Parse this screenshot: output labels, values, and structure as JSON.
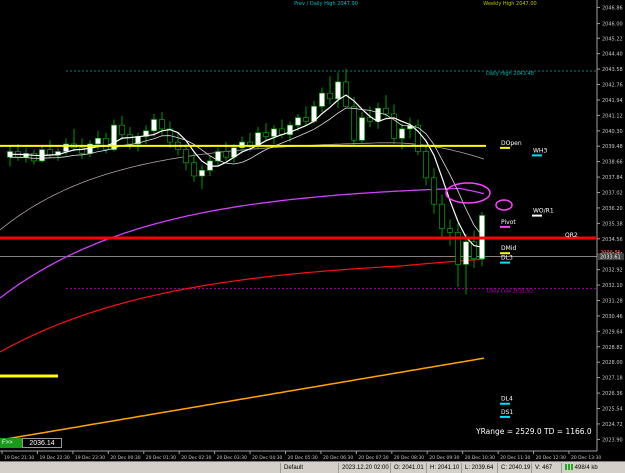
{
  "chart_data": {
    "type": "candlestick",
    "timeframe_labels": [
      "19 Dec 21:30",
      "19 Dec 22:30",
      "19 Dec 23:30",
      "20 Dec 00:30",
      "20 Dec 01:30",
      "20 Dec 02:30",
      "20 Dec 03:30",
      "20 Dec 04:30",
      "20 Dec 05:30",
      "20 Dec 06:30",
      "20 Dec 07:30",
      "20 Dec 08:30",
      "20 Dec 09:30",
      "20 Dec 10:30",
      "20 Dec 11:30",
      "20 Dec 12:30",
      "20 Dec 13:30"
    ],
    "y_ticks": [
      "2046.86",
      "2046.00",
      "2045.22",
      "2044.40",
      "2043.58",
      "2042.76",
      "2041.94",
      "2041.12",
      "2040.30",
      "2039.48",
      "2038.66",
      "2037.84",
      "2037.02",
      "2036.20",
      "2035.38",
      "2034.56",
      "2033.74",
      "2032.92",
      "2032.10",
      "2031.28",
      "2030.46",
      "2029.64",
      "2028.82",
      "2028.00",
      "2027.18",
      "2026.36",
      "2025.54",
      "2024.72",
      "2023.90"
    ],
    "ylim": [
      2023.6,
      2047.2
    ],
    "current_price_tag": "2033.61",
    "price_tag_2": "2033.86",
    "candles": [
      [
        2038.9,
        2039.5,
        2038.4,
        2039.2
      ],
      [
        2039.2,
        2039.6,
        2038.7,
        2038.9
      ],
      [
        2038.9,
        2039.4,
        2038.6,
        2039.1
      ],
      [
        2039.1,
        2039.3,
        2038.5,
        2038.7
      ],
      [
        2038.7,
        2039.5,
        2038.6,
        2039.3
      ],
      [
        2039.3,
        2039.8,
        2038.9,
        2039.0
      ],
      [
        2039.0,
        2039.4,
        2038.7,
        2039.2
      ],
      [
        2039.2,
        2039.9,
        2039.0,
        2039.6
      ],
      [
        2039.6,
        2040.4,
        2039.2,
        2039.4
      ],
      [
        2039.4,
        2039.9,
        2038.8,
        2039.1
      ],
      [
        2039.1,
        2039.8,
        2038.9,
        2039.6
      ],
      [
        2039.6,
        2040.3,
        2039.3,
        2039.9
      ],
      [
        2039.9,
        2040.2,
        2039.1,
        2039.3
      ],
      [
        2039.3,
        2040.9,
        2039.2,
        2040.6
      ],
      [
        2040.6,
        2041.1,
        2039.8,
        2040.1
      ],
      [
        2040.1,
        2040.5,
        2039.3,
        2039.6
      ],
      [
        2039.6,
        2040.2,
        2039.2,
        2040.0
      ],
      [
        2040.0,
        2040.6,
        2039.6,
        2040.3
      ],
      [
        2040.3,
        2041.2,
        2040.0,
        2040.9
      ],
      [
        2040.9,
        2041.3,
        2040.1,
        2040.4
      ],
      [
        2040.4,
        2040.8,
        2039.4,
        2039.7
      ],
      [
        2039.7,
        2040.2,
        2039.0,
        2039.3
      ],
      [
        2039.3,
        2039.6,
        2038.2,
        2038.6
      ],
      [
        2038.6,
        2039.1,
        2037.6,
        2037.9
      ],
      [
        2037.9,
        2038.5,
        2037.2,
        2038.2
      ],
      [
        2038.2,
        2039.0,
        2037.9,
        2038.7
      ],
      [
        2038.7,
        2039.4,
        2038.4,
        2039.2
      ],
      [
        2039.2,
        2039.7,
        2038.7,
        2038.9
      ],
      [
        2038.9,
        2039.6,
        2038.6,
        2039.4
      ],
      [
        2039.4,
        2040.0,
        2039.1,
        2039.7
      ],
      [
        2039.7,
        2040.2,
        2039.2,
        2039.5
      ],
      [
        2039.5,
        2040.5,
        2039.3,
        2040.2
      ],
      [
        2040.2,
        2040.7,
        2039.8,
        2040.0
      ],
      [
        2040.0,
        2040.6,
        2039.6,
        2040.4
      ],
      [
        2040.4,
        2040.9,
        2039.9,
        2040.1
      ],
      [
        2040.1,
        2040.8,
        2039.7,
        2040.6
      ],
      [
        2040.6,
        2041.2,
        2040.3,
        2041.0
      ],
      [
        2041.0,
        2041.6,
        2040.6,
        2040.8
      ],
      [
        2040.8,
        2041.9,
        2040.7,
        2041.6
      ],
      [
        2041.6,
        2042.6,
        2041.3,
        2042.3
      ],
      [
        2042.3,
        2043.2,
        2041.7,
        2042.0
      ],
      [
        2042.0,
        2043.4,
        2041.5,
        2042.9
      ],
      [
        2042.9,
        2043.6,
        2041.8,
        2041.6
      ],
      [
        2041.6,
        2042.1,
        2039.5,
        2039.8
      ],
      [
        2039.8,
        2041.3,
        2039.6,
        2041.0
      ],
      [
        2041.0,
        2041.6,
        2040.5,
        2040.8
      ],
      [
        2040.8,
        2041.8,
        2040.4,
        2041.5
      ],
      [
        2041.5,
        2042.2,
        2041.0,
        2041.2
      ],
      [
        2041.2,
        2041.7,
        2039.6,
        2039.9
      ],
      [
        2039.9,
        2040.7,
        2039.3,
        2040.4
      ],
      [
        2040.4,
        2041.0,
        2039.9,
        2040.6
      ],
      [
        2040.6,
        2040.9,
        2039.0,
        2039.2
      ],
      [
        2039.2,
        2039.6,
        2037.4,
        2037.8
      ],
      [
        2037.8,
        2038.3,
        2035.9,
        2036.4
      ],
      [
        2036.4,
        2036.9,
        2034.6,
        2035.1
      ],
      [
        2035.1,
        2035.6,
        2034.2,
        2034.9
      ],
      [
        2034.9,
        2035.4,
        2032.0,
        2033.2
      ],
      [
        2033.2,
        2034.8,
        2031.6,
        2034.4
      ],
      [
        2034.4,
        2035.0,
        2033.0,
        2033.5
      ],
      [
        2033.5,
        2036.0,
        2033.1,
        2035.8
      ]
    ],
    "h_lines": [
      {
        "name": "Prev / Daily High 2047.00",
        "price": 2047.0,
        "color": "#00c0c0"
      },
      {
        "name": "Weekly High 2047.00",
        "price": 2047.0,
        "color": "#c0c000"
      },
      {
        "name": "Daily High 2043.48",
        "price": 2043.48,
        "color": "#00b0b0"
      },
      {
        "name": "Daily Low 2031.92",
        "price": 2031.92,
        "color": "#c000c0"
      }
    ],
    "levels": [
      {
        "label": "DOpen",
        "price": 2039.5,
        "color": "#ffff00"
      },
      {
        "label": "WH3",
        "price": 2039.1,
        "color": "#00e0ff"
      },
      {
        "label": "WO/R1",
        "price": 2035.9,
        "color": "#ffffff"
      },
      {
        "label": "Pivot",
        "price": 2035.3,
        "color": "#ff40ff"
      },
      {
        "label": "QR2",
        "price": 2034.6,
        "color": "#ff3030"
      },
      {
        "label": "DMid",
        "price": 2033.9,
        "color": "#ffff00"
      },
      {
        "label": "DL3",
        "price": 2033.4,
        "color": "#00e0ff"
      },
      {
        "label": "DL4",
        "price": 2025.9,
        "color": "#00e0ff"
      },
      {
        "label": "DS1",
        "price": 2025.2,
        "color": "#00e0ff"
      }
    ],
    "footer_text": "YRange = 2529.0    TD = 1166.0",
    "bottom_left_price": "2036.14"
  },
  "statusbar": {
    "profile": "Default",
    "datetime": "2023.12.20 02:00",
    "open": "O: 2041.01",
    "high": "H: 2041.10",
    "low": "L: 2039.64",
    "close": "C: 2040.19",
    "volume": "V: 467",
    "traffic": "498/4 kb"
  },
  "quick_button": "F>>",
  "colors": {
    "bull": "#ffffff",
    "bear": "#000000",
    "bear_border": "#00c000",
    "bull_border": "#00c000",
    "yellow": "#ffff00",
    "red": "#ff0000",
    "magenta": "#d040ff",
    "orange": "#ffa500",
    "grid": "#303030"
  }
}
